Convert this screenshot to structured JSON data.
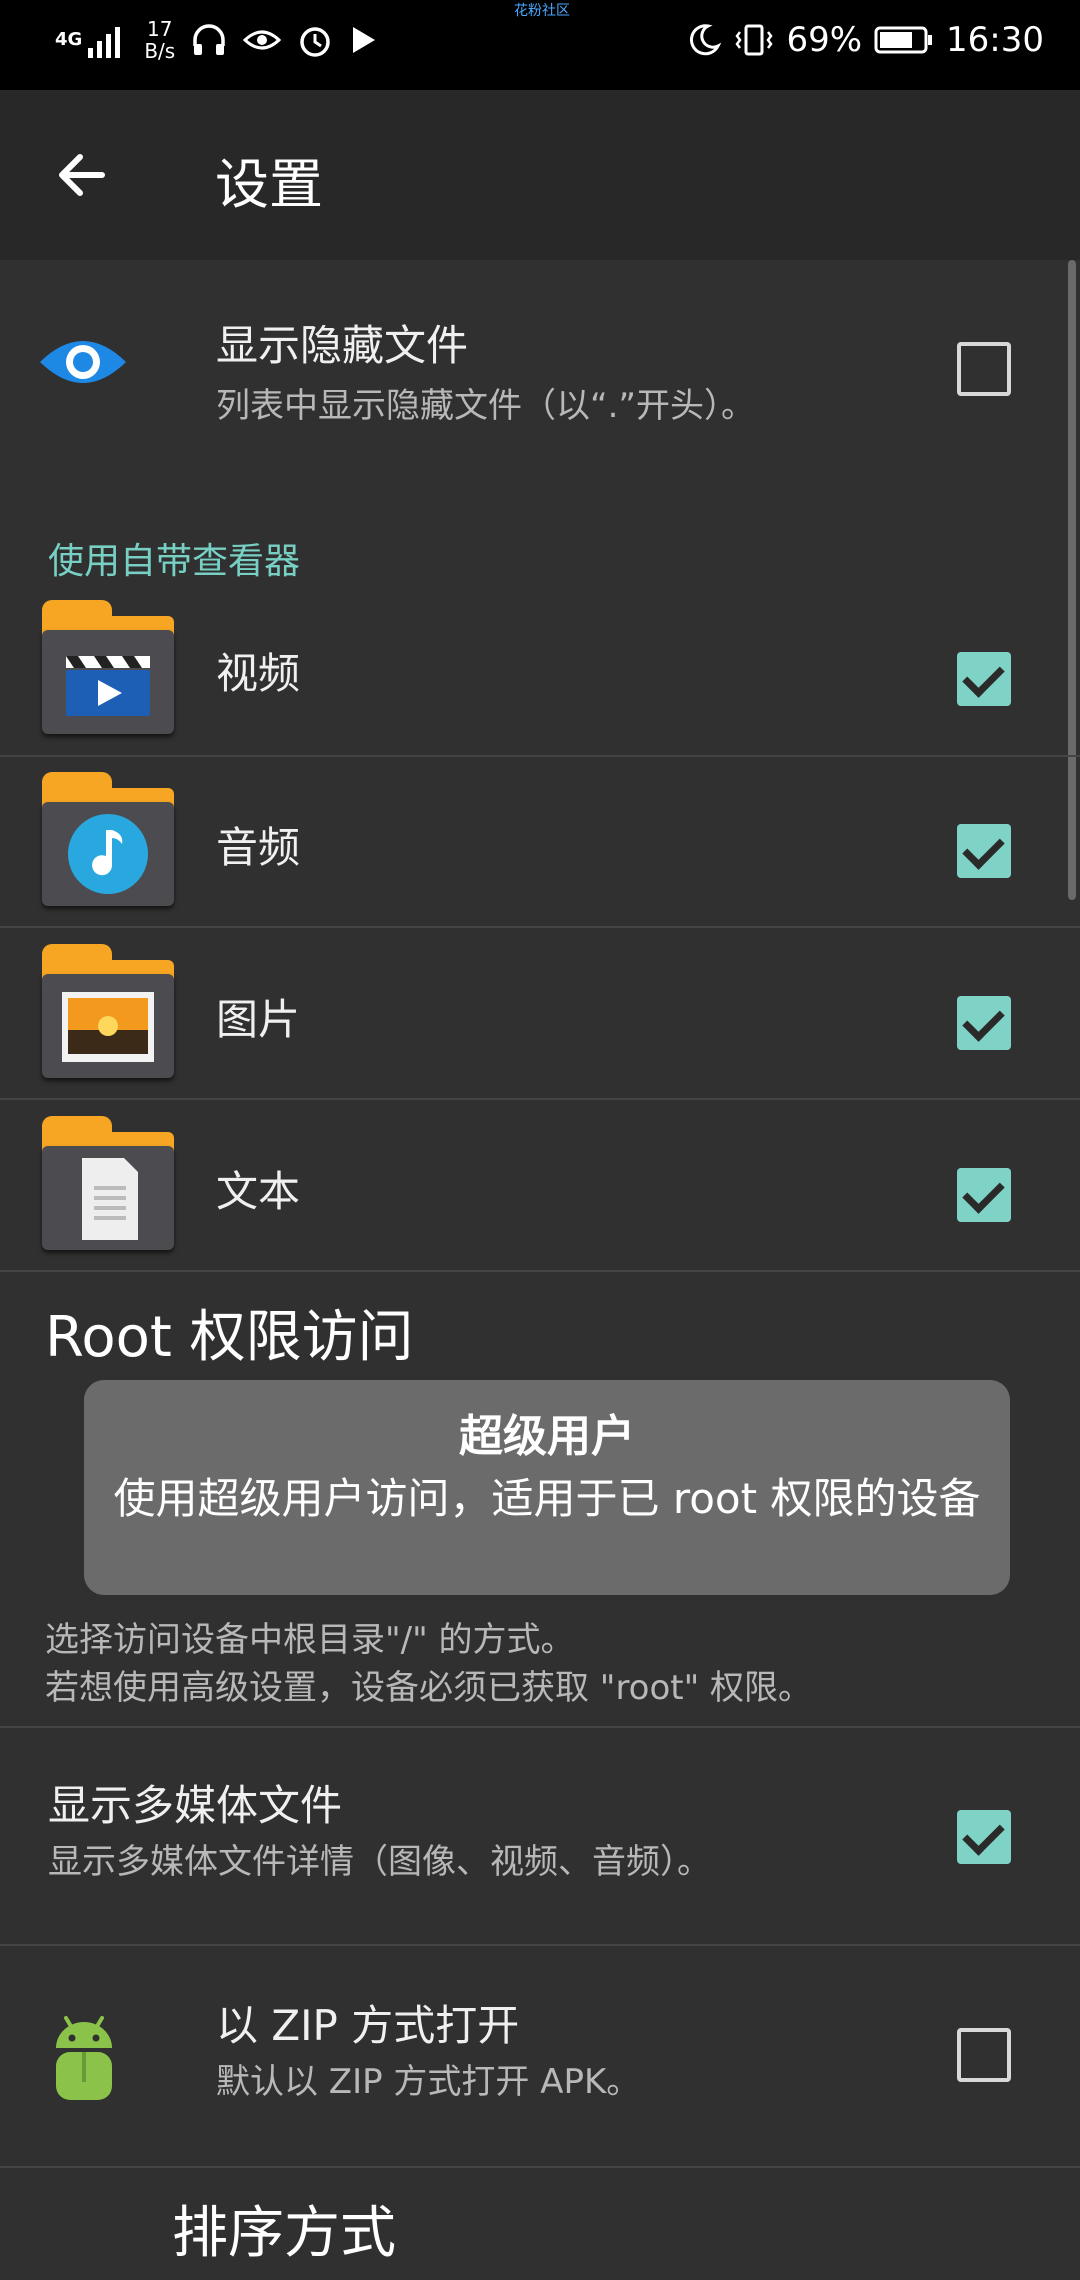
{
  "statusbar": {
    "network": "4G",
    "speed_value": "17",
    "speed_unit": "B/s",
    "top_label": "花粉社区",
    "battery": "69%",
    "time": "16:30"
  },
  "toolbar": {
    "title": "设置"
  },
  "settings": {
    "hidden_files": {
      "label": "显示隐藏文件",
      "summary": "列表中显示隐藏文件（以“.”开头）。",
      "checked": false
    },
    "viewer_section": "使用自带查看器",
    "viewers": [
      {
        "label": "视频",
        "checked": true,
        "icon": "video-folder-icon"
      },
      {
        "label": "音频",
        "checked": true,
        "icon": "audio-folder-icon"
      },
      {
        "label": "图片",
        "checked": true,
        "icon": "image-folder-icon"
      },
      {
        "label": "文本",
        "checked": true,
        "icon": "text-folder-icon"
      }
    ],
    "root": {
      "title": "Root 权限访问",
      "summary_line1": "选择访问设备中根目录\"/\" 的方式。",
      "summary_line2": "若想使用高级设置，设备必须已获取 \"root\" 权限。"
    },
    "media": {
      "label": "显示多媒体文件",
      "summary": "显示多媒体文件详情（图像、视频、音频）。",
      "checked": true
    },
    "zip": {
      "label": "以 ZIP 方式打开",
      "summary": "默认以 ZIP 方式打开 APK。",
      "checked": false
    },
    "sort_title": "排序方式"
  },
  "toast": {
    "title": "超级用户",
    "message": "使用超级用户访问，适用于已 root 权限的设备"
  },
  "colors": {
    "accent": "#77d0c3",
    "checkbox_checked": "#7fd2c6",
    "folder": "#f6a623"
  }
}
